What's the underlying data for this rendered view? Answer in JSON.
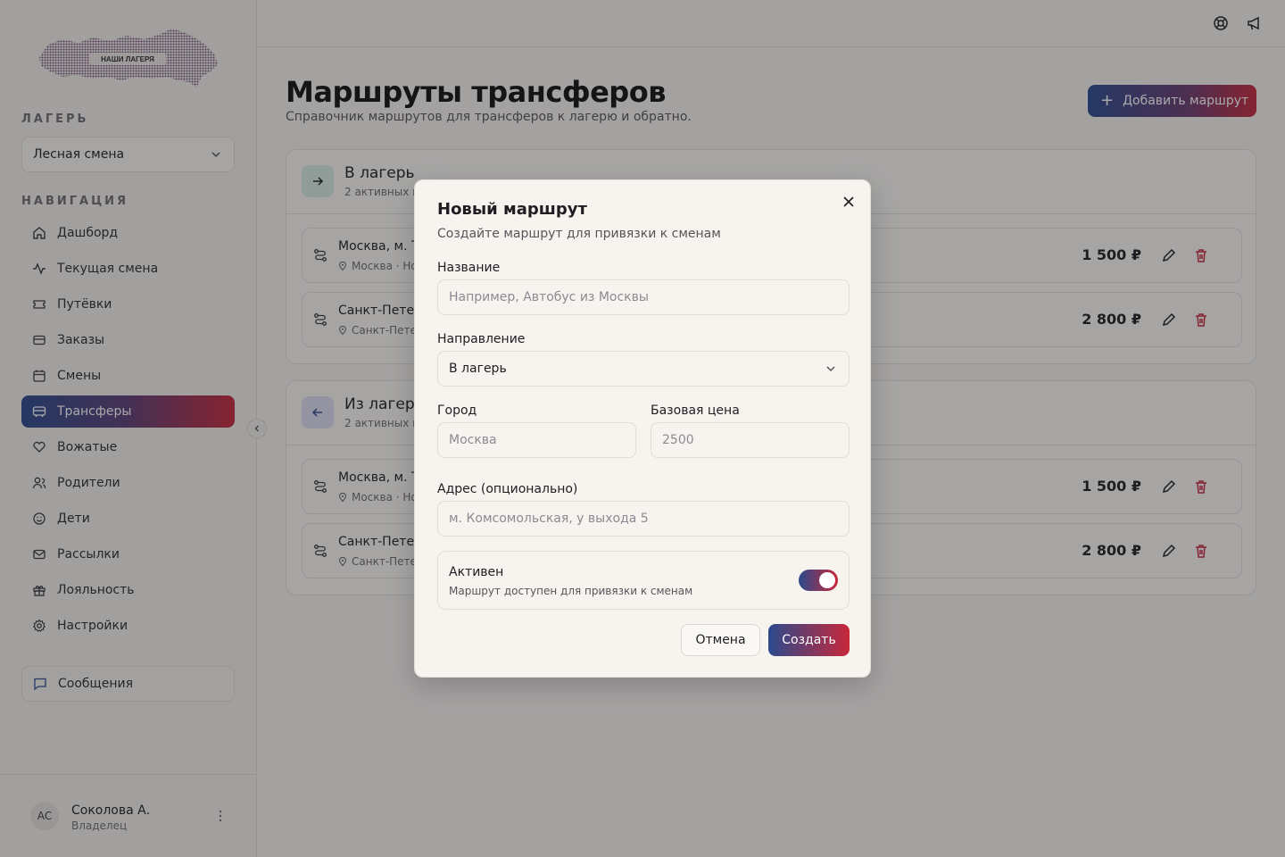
{
  "brand": {
    "logo_text": "НАШИ ЛАГЕРЯ",
    "accent_blue": "#2a4a8d",
    "accent_red": "#c8283a"
  },
  "sidebar": {
    "camp_section_label": "ЛАГЕРЬ",
    "camp_selected": "Лесная смена",
    "nav_section_label": "НАВИГАЦИЯ",
    "items": [
      {
        "label": "Дашборд",
        "icon": "home-icon"
      },
      {
        "label": "Текущая смена",
        "icon": "activity-icon"
      },
      {
        "label": "Путёвки",
        "icon": "ticket-icon"
      },
      {
        "label": "Заказы",
        "icon": "card-icon"
      },
      {
        "label": "Смены",
        "icon": "calendar-icon"
      },
      {
        "label": "Трансферы",
        "icon": "bus-icon",
        "active": true
      },
      {
        "label": "Вожатые",
        "icon": "heart-hand-icon"
      },
      {
        "label": "Родители",
        "icon": "users-icon"
      },
      {
        "label": "Дети",
        "icon": "smile-icon"
      },
      {
        "label": "Рассылки",
        "icon": "mail-icon"
      },
      {
        "label": "Лояльность",
        "icon": "gift-icon"
      },
      {
        "label": "Настройки",
        "icon": "gear-icon"
      }
    ],
    "messages_label": "Сообщения",
    "user": {
      "initials": "АС",
      "name": "Соколова А.",
      "role": "Владелец"
    }
  },
  "header": {
    "title": "Маршруты трансферов",
    "subtitle": "Справочник маршрутов для трансферов к лагерю и обратно.",
    "add_button": "Добавить маршрут"
  },
  "groups": [
    {
      "title": "В лагерь",
      "subtitle": "2 активных и",
      "routes": [
        {
          "name": "Москва, м. Т",
          "address": "Москва · Но",
          "price": "1 500 ₽"
        },
        {
          "name": "Санкт-Петер",
          "address": "Санкт-Пете",
          "price": "2 800 ₽"
        }
      ]
    },
    {
      "title": "Из лагеря",
      "subtitle": "2 активных и",
      "routes": [
        {
          "name": "Москва, м. Т",
          "address": "Москва · Но",
          "price": "1 500 ₽"
        },
        {
          "name": "Санкт-Петер",
          "address": "Санкт-Пете",
          "price": "2 800 ₽"
        }
      ]
    }
  ],
  "modal": {
    "title": "Новый маршрут",
    "subtitle": "Создайте маршрут для привязки к сменам",
    "name_label": "Название",
    "name_placeholder": "Например, Автобус из Москвы",
    "direction_label": "Направление",
    "direction_value": "В лагерь",
    "city_label": "Город",
    "city_placeholder": "Москва",
    "price_label": "Базовая цена",
    "price_placeholder": "2500",
    "address_label": "Адрес (опционально)",
    "address_placeholder": "м. Комсомольская, у выхода 5",
    "active_title": "Активен",
    "active_sub": "Маршрут доступен для привязки к сменам",
    "active_on": true,
    "cancel": "Отмена",
    "create": "Создать"
  }
}
